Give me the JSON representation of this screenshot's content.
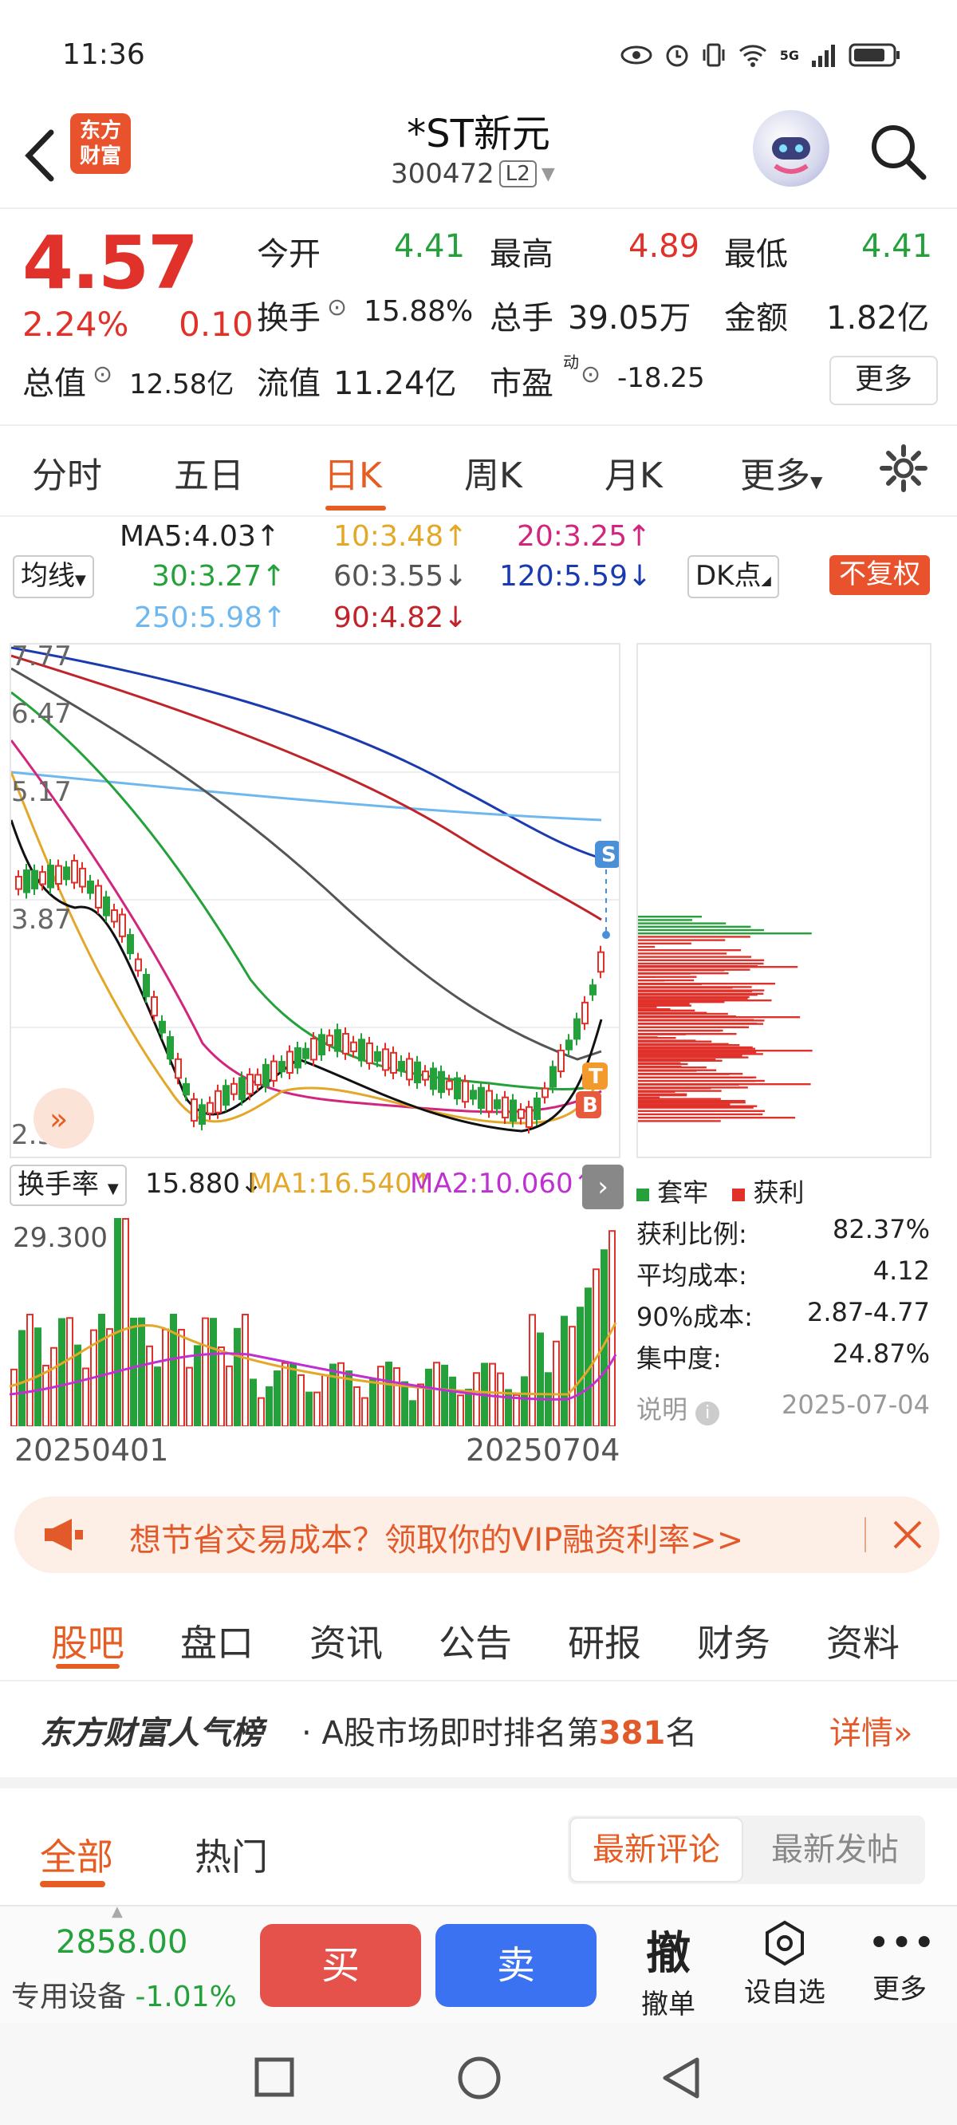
{
  "status": {
    "time": "11:36",
    "signal": "5G"
  },
  "header": {
    "stock_name": "*ST新元",
    "stock_code": "300472",
    "level": "L2",
    "brand": "东方财富"
  },
  "quote": {
    "price": "4.57",
    "change_pct": "2.24%",
    "change": "0.10",
    "open_label": "今开",
    "open": "4.41",
    "high_label": "最高",
    "high": "4.89",
    "low_label": "最低",
    "low": "4.41",
    "turnover_label": "换手",
    "turnover": "15.88%",
    "volume_label": "总手",
    "volume": "39.05万",
    "amount_label": "金额",
    "amount": "1.82亿",
    "mktcap_label": "总值",
    "mktcap": "12.58亿",
    "float_label": "流值",
    "float_cap": "11.24亿",
    "pe_label": "市盈",
    "pe_sup": "动",
    "pe": "-18.25",
    "more": "更多"
  },
  "tabs": [
    "分时",
    "五日",
    "日K",
    "周K",
    "月K",
    "更多"
  ],
  "active_tab": "日K",
  "ma": {
    "selector": "均线",
    "ma5": "MA5:4.03↑",
    "ma10": "10:3.48↑",
    "ma20": "20:3.25↑",
    "ma30": "30:3.27↑",
    "ma60": "60:3.55↓",
    "ma120": "120:5.59↓",
    "ma250": "250:5.98↑",
    "ma90": "90:4.82↓",
    "dk": "DK点",
    "fuquan": "不复权"
  },
  "chart_data": {
    "type": "line",
    "y_ticks": [
      "7.77",
      "6.47",
      "5.17",
      "3.87",
      "2.57"
    ],
    "x_start": "20250401",
    "x_end": "20250704",
    "markers": [
      "S",
      "T",
      "B"
    ]
  },
  "volume": {
    "selector": "换手率",
    "value": "15.880↓",
    "ma1": "MA1:16.540↑",
    "ma2": "MA2:10.060↑",
    "y_top": "29.300"
  },
  "cost": {
    "legend_trapped": "套牢",
    "legend_profit": "获利",
    "rows": [
      {
        "label": "获利比例:",
        "value": "82.37%"
      },
      {
        "label": "平均成本:",
        "value": "4.12"
      },
      {
        "label": "90%成本:",
        "value": "2.87-4.77"
      },
      {
        "label": "集中度:",
        "value": "24.87%"
      }
    ],
    "note": "说明",
    "date": "2025-07-04"
  },
  "colors": {
    "up": "#e0312a",
    "down": "#25a13b",
    "accent": "#e65d23"
  },
  "ad": {
    "text": "想节省交易成本？领取你的VIP融资利率>>"
  },
  "subtabs": [
    "股吧",
    "盘口",
    "资讯",
    "公告",
    "研报",
    "财务",
    "资料"
  ],
  "rank": {
    "title": "东方财富人气榜",
    "text_prefix": "· A股市场即时排名第",
    "rank": "381",
    "text_suffix": "名",
    "detail": "详情"
  },
  "posts": {
    "all": "全部",
    "hot": "热门",
    "latest_comment": "最新评论",
    "latest_post": "最新发帖"
  },
  "bottom": {
    "index_value": "2858.00",
    "index_name": "专用设备",
    "index_change": "-1.01%",
    "buy": "买",
    "sell": "卖",
    "cancel_icon": "撤",
    "cancel": "撤单",
    "watch": "设自选",
    "more": "更多"
  }
}
